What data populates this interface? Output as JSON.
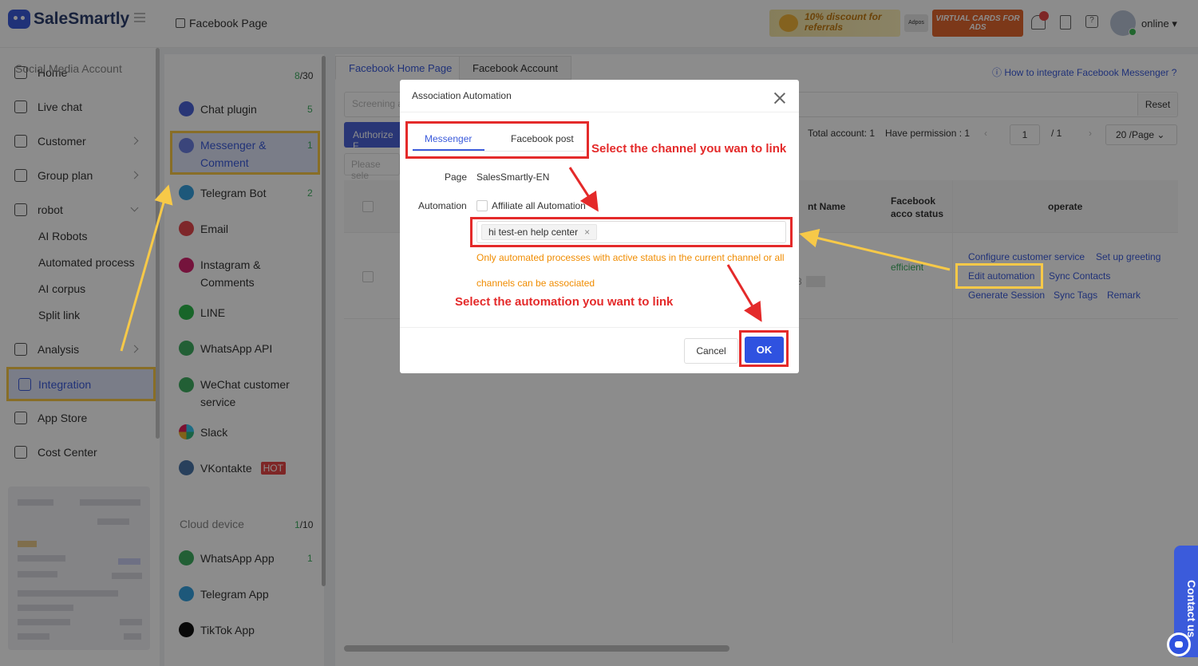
{
  "app": {
    "name": "SaleSmartly",
    "breadcrumb": "Facebook Page"
  },
  "top": {
    "promo1": "10% discount for referrals",
    "adpos": "Adpos",
    "promo2": "VIRTUAL CARDS FOR ADS",
    "status": "online"
  },
  "nav": {
    "home": "Home",
    "live_chat": "Live chat",
    "customer": "Customer",
    "group_plan": "Group plan",
    "robot": "robot",
    "ai_robots": "AI Robots",
    "automated_process": "Automated process",
    "ai_corpus": "AI corpus",
    "split_link": "Split link",
    "analysis": "Analysis",
    "integration": "Integration",
    "app_store": "App Store",
    "cost_center": "Cost Center"
  },
  "channels": {
    "social_title": "Social Media Account",
    "social_count": "8",
    "social_total": "/30",
    "chat_plugin": "Chat plugin",
    "chat_plugin_cnt": "5",
    "messenger": "Messenger & Comment",
    "messenger_cnt": "1",
    "telegram_bot": "Telegram Bot",
    "telegram_bot_cnt": "2",
    "email": "Email",
    "instagram": "Instagram & Comments",
    "line": "LINE",
    "whatsapp_api": "WhatsApp API",
    "wechat": "WeChat customer service",
    "slack": "Slack",
    "vk": "VKontakte",
    "hot": "HOT",
    "cloud_title": "Cloud device",
    "cloud_count": "1",
    "cloud_total": "/10",
    "whatsapp_app": "WhatsApp App",
    "whatsapp_app_cnt": "1",
    "telegram_app": "Telegram App",
    "tiktok_app": "TikTok App"
  },
  "main": {
    "tab1": "Facebook Home Page",
    "tab2": "Facebook Account",
    "how": "How to integrate Facebook Messenger ?",
    "filter_placeholder": "Screening a",
    "reset": "Reset",
    "authorize": "Authorize F",
    "please": "Please sele",
    "total": "Total account: 1",
    "permission": "Have permission : 1",
    "page_num": "1",
    "page_total": "/ 1",
    "per_page": "20 /Page",
    "col_name": "nt Name",
    "col_status": "Facebook acco status",
    "col_operate": "operate",
    "partial_text": "8",
    "status_value": "efficient",
    "ops": [
      "Configure customer service",
      "Set up greeting",
      "Edit automation",
      "Sync Contacts",
      "Generate Session",
      "Sync Tags",
      "Remark"
    ]
  },
  "dialog": {
    "title": "Association Automation",
    "tab_messenger": "Messenger",
    "tab_post": "Facebook post",
    "page_label": "Page",
    "page_value": "SalesSmartly-EN",
    "automation_label": "Automation",
    "affiliate_label": "Affiliate all Automation",
    "tag": "hi test-en help center",
    "tag_remove": "×",
    "hint_line1": "Only automated processes with active status in the current channel or all",
    "hint_line2": "channels can be associated",
    "cancel": "Cancel",
    "ok": "OK"
  },
  "annotations": {
    "channel": "Select the channel you wan to link",
    "automation": "Select the automation you want to link"
  },
  "contact": "Contact us",
  "colors": {
    "accent": "#3b5bdb",
    "annotation_red": "#e42a2a",
    "highlight_yellow": "#f7c948",
    "hint_orange": "#f08c00"
  }
}
